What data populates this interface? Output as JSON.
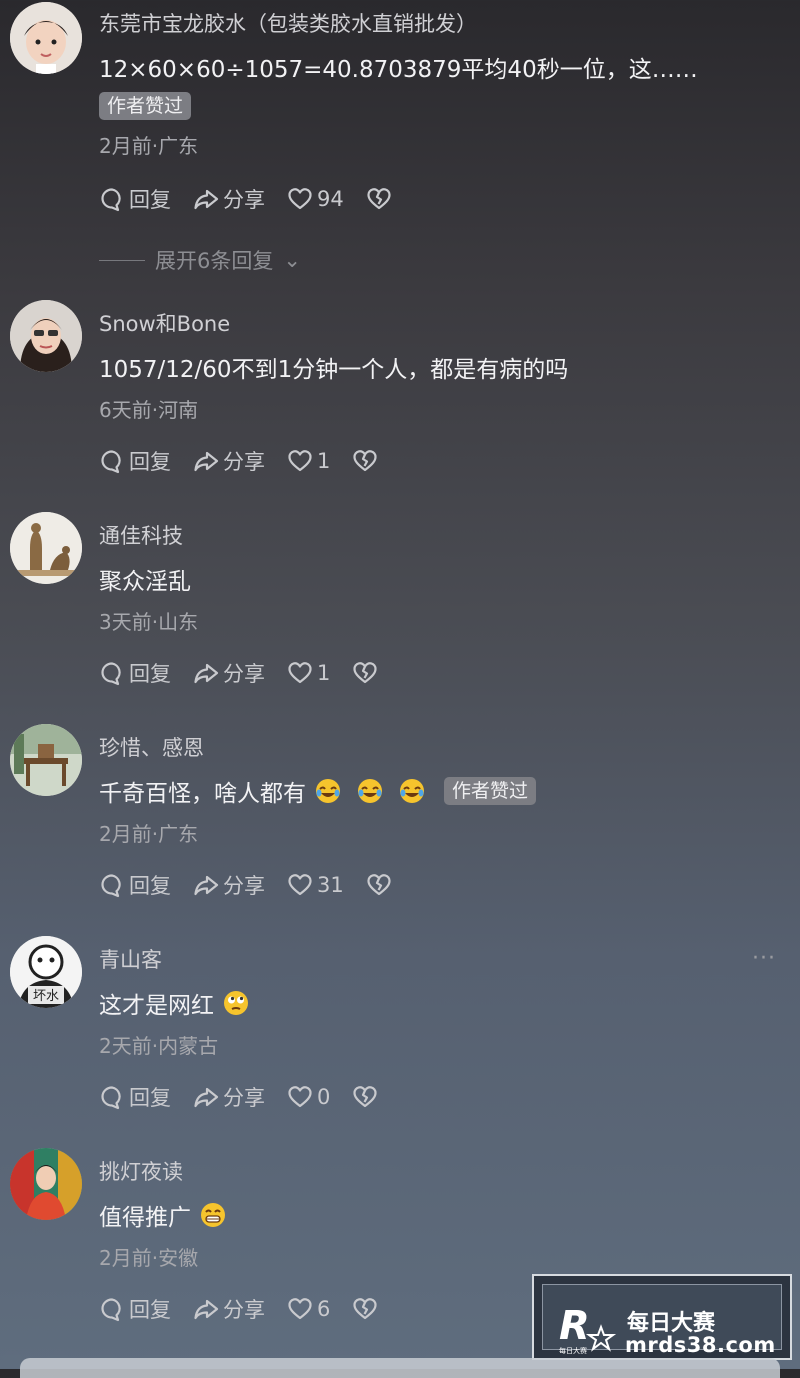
{
  "comments": [
    {
      "name": "东莞市宝龙胶水（包装类胶水直销批发）",
      "text": "12×60×60÷1057=40.8703879平均40秒一位，这……",
      "badge": "作者赞过",
      "meta": "2月前·广东",
      "reply": "回复",
      "share": "分享",
      "likes": "94",
      "expand": "展开6条回复"
    },
    {
      "name": "Snow和Bone",
      "text": "1057/12/60不到1分钟一个人，都是有病的吗",
      "meta": "6天前·河南",
      "reply": "回复",
      "share": "分享",
      "likes": "1"
    },
    {
      "name": "通佳科技",
      "text": "聚众淫乱",
      "meta": "3天前·山东",
      "reply": "回复",
      "share": "分享",
      "likes": "1"
    },
    {
      "name": "珍惜、感恩",
      "text": "千奇百怪，啥人都有",
      "badge": "作者赞过",
      "meta": "2月前·广东",
      "reply": "回复",
      "share": "分享",
      "likes": "31"
    },
    {
      "name": "青山客",
      "text": "这才是网红",
      "meta": "2天前·内蒙古",
      "more": "···",
      "reply": "回复",
      "share": "分享",
      "likes": "0"
    },
    {
      "name": "挑灯夜读",
      "text": "值得推广",
      "meta": "2月前·安徽",
      "reply": "回复",
      "share": "分享",
      "likes": "6"
    }
  ],
  "avatar5_text": "坏水",
  "watermark": {
    "title": "每日大赛",
    "url": "mrds38.com",
    "logo_small": "每日大赛"
  },
  "icons": [
    "comment-bubble-icon",
    "share-arrow-icon",
    "heart-icon",
    "broken-heart-icon",
    "laughing-emoji-icon",
    "rolling-eyes-emoji-icon",
    "grin-emoji-icon",
    "chevron-down-icon"
  ]
}
